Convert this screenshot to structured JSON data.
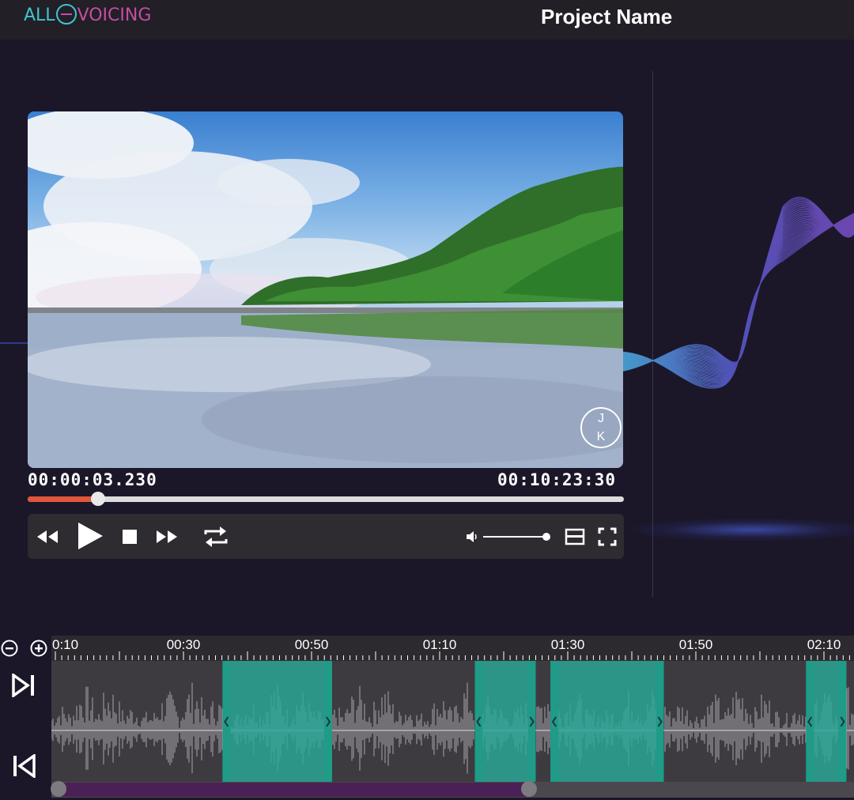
{
  "app": {
    "logo_part1": "ALL",
    "logo_part2": "VOICING",
    "project_title": "Project Name"
  },
  "player": {
    "current_time": "00:00:03.230",
    "total_time": "00:10:23:30",
    "progress": 0.118,
    "volume": 1.0,
    "watermark_top": "J",
    "watermark_bottom": "K",
    "controls": [
      "rewind-icon",
      "play-icon",
      "stop-icon",
      "fast-forward-icon",
      "repeat-icon",
      "volume-icon",
      "subtitle-icon",
      "fullscreen-icon"
    ]
  },
  "timeline": {
    "tick_labels": [
      "0:10",
      "00:30",
      "00:50",
      "01:10",
      "01:30",
      "01:50",
      "02:10"
    ],
    "tick_seconds": [
      10,
      30,
      50,
      70,
      90,
      110,
      130
    ],
    "segments": [
      {
        "start_sec": 36.1,
        "end_sec": 53.2
      },
      {
        "start_sec": 75.5,
        "end_sec": 85.0
      },
      {
        "start_sec": 87.3,
        "end_sec": 105.0
      },
      {
        "start_sec": 127.2,
        "end_sec": 133.5
      }
    ],
    "scroll_position": 0.59,
    "accent_color": "#2aa898",
    "buttons": [
      "zoom-out-icon",
      "zoom-in-icon",
      "jump-next-icon",
      "jump-previous-icon"
    ]
  }
}
